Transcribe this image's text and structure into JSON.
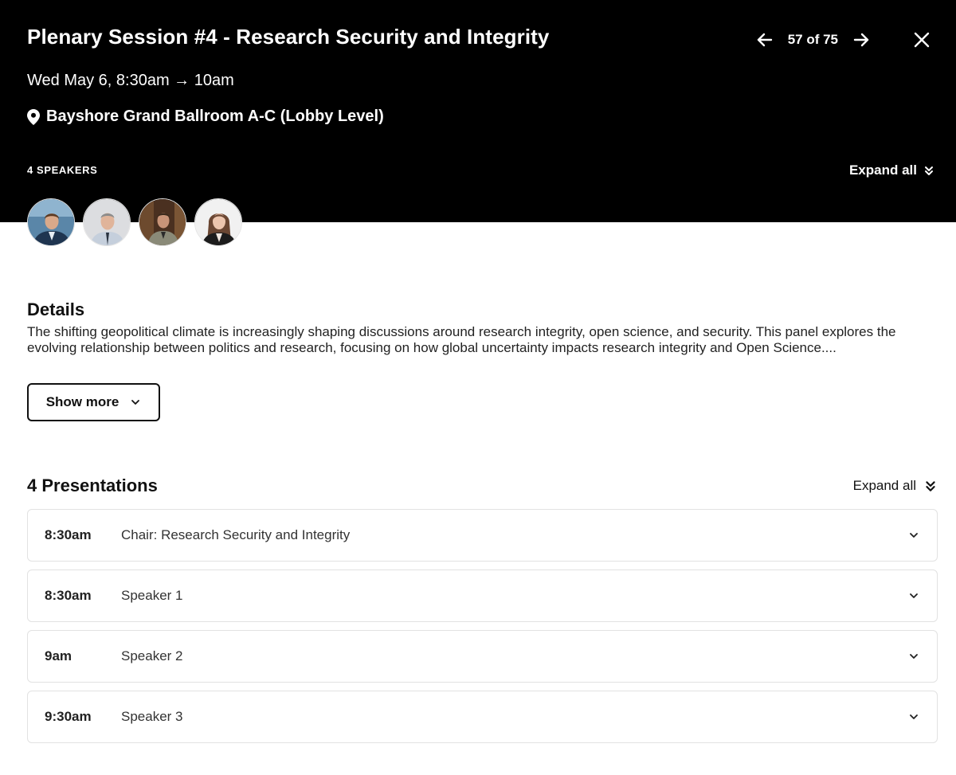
{
  "header": {
    "title": "Plenary Session #4 - Research Security and Integrity",
    "time": "Wed May 6, 8:30am → 10am",
    "location": "Bayshore Grand Ballroom A-C (Lobby Level)",
    "speakers_label": "4 SPEAKERS",
    "expand_all_label": "Expand all",
    "nav": {
      "counter": "57 of 75",
      "prev_icon": "arrow-left-icon",
      "next_icon": "arrow-right-icon",
      "close_icon": "close-icon"
    },
    "background_color": "#000000"
  },
  "speakers": [
    {
      "name": "speaker-avatar-1"
    },
    {
      "name": "speaker-avatar-2"
    },
    {
      "name": "speaker-avatar-3"
    },
    {
      "name": "speaker-avatar-4"
    }
  ],
  "details": {
    "heading": "Details",
    "text": "The shifting geopolitical climate is increasingly shaping discussions around research integrity, open science, and security. This panel explores the evolving relationship between politics and research, focusing on how global uncertainty impacts research integrity and Open Science....",
    "show_more_label": "Show more"
  },
  "presentations": {
    "heading": "4 Presentations",
    "expand_all_label": "Expand all",
    "items": [
      {
        "time": "8:30am",
        "title": "Chair: Research Security and Integrity"
      },
      {
        "time": "8:30am",
        "title": "Speaker 1"
      },
      {
        "time": "9am",
        "title": "Speaker 2"
      },
      {
        "time": "9:30am",
        "title": "Speaker 3"
      }
    ]
  }
}
